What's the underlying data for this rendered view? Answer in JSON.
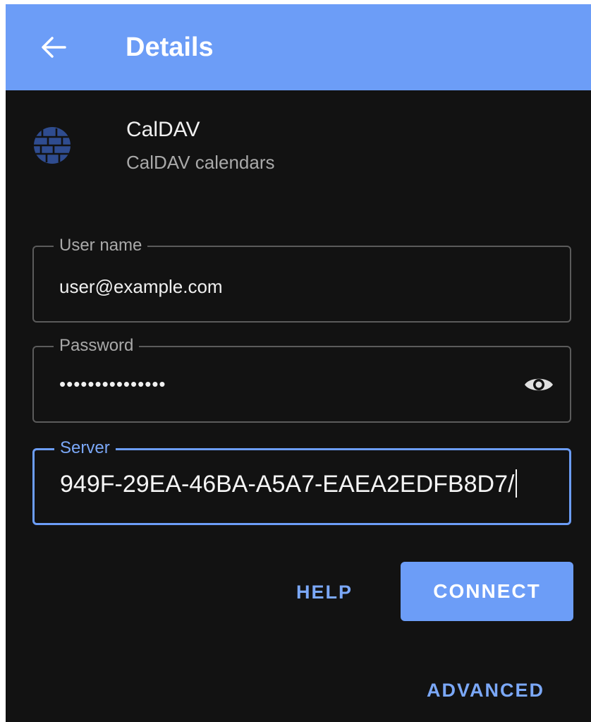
{
  "appbar": {
    "title": "Details",
    "back_icon": "arrow-left-icon",
    "color": "#6c9df7"
  },
  "account": {
    "icon": "caldav-globe-icon",
    "name": "CalDAV",
    "description": "CalDAV calendars"
  },
  "form": {
    "username": {
      "label": "User name",
      "value": "user@example.com"
    },
    "password": {
      "label": "Password",
      "value": "•••••••••••••••",
      "toggle_icon": "eye-icon"
    },
    "server": {
      "label": "Server",
      "value": "949F-29EA-46BA-A5A7-EAEA2EDFB8D7/"
    }
  },
  "actions": {
    "help_label": "HELP",
    "connect_label": "CONNECT",
    "advanced_label": "ADVANCED"
  },
  "colors": {
    "accent": "#6c9df7",
    "background": "#121212",
    "text_primary": "#f0f0f0",
    "text_secondary": "#a9a9a9"
  }
}
